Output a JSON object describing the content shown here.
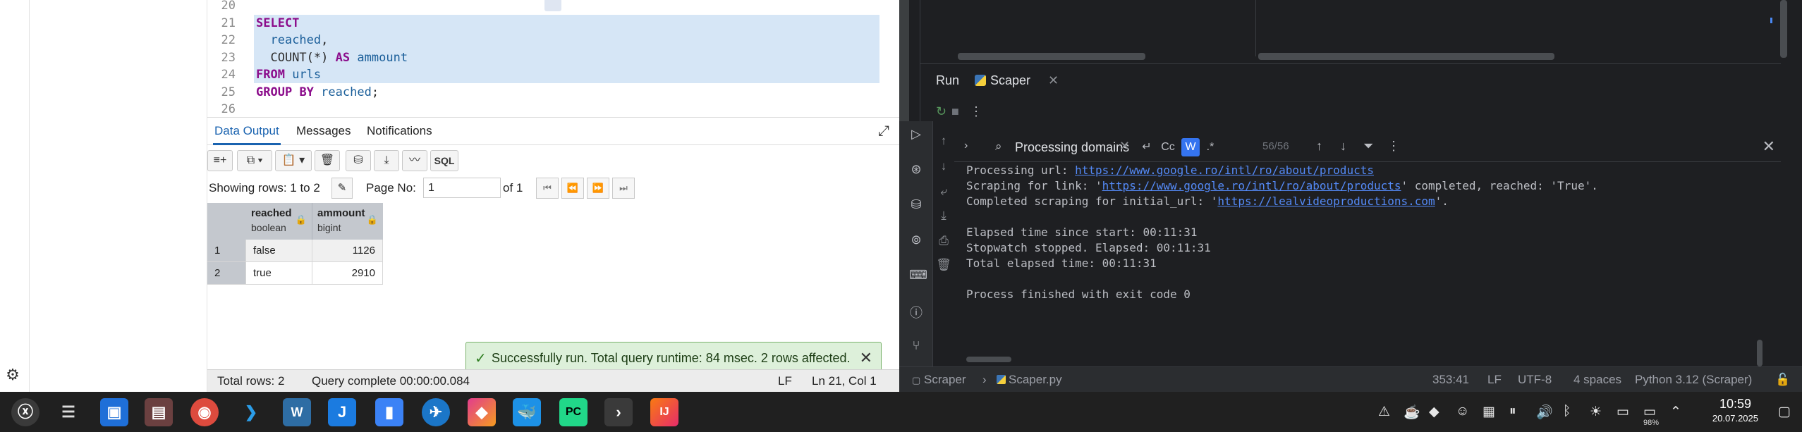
{
  "editor": {
    "lines": [
      {
        "num": "20",
        "text": ""
      },
      {
        "num": "21",
        "text": "SELECT"
      },
      {
        "num": "22",
        "text": "  reached,"
      },
      {
        "num": "23",
        "text": "  COUNT(*) AS ammount"
      },
      {
        "num": "24",
        "text": "FROM urls"
      },
      {
        "num": "25",
        "text": "GROUP BY reached;"
      },
      {
        "num": "26",
        "text": ""
      }
    ]
  },
  "results": {
    "tabs": [
      "Data Output",
      "Messages",
      "Notifications"
    ],
    "active_tab": "Data Output",
    "toolbar_sql_label": "SQL",
    "showing_rows": "Showing rows: 1 to 2",
    "page_no_label": "Page No:",
    "page_no_value": "1",
    "page_of": "of 1",
    "columns": [
      {
        "name": "reached",
        "type": "boolean"
      },
      {
        "name": "ammount",
        "type": "bigint"
      }
    ],
    "rows": [
      {
        "n": "1",
        "reached": "false",
        "ammount": "1126"
      },
      {
        "n": "2",
        "reached": "true",
        "ammount": "2910"
      }
    ],
    "toast": "Successfully run. Total query runtime: 84 msec. 2 rows affected.",
    "status": {
      "total_rows": "Total rows: 2",
      "query_complete": "Query complete 00:00:00.084",
      "line_ending": "LF",
      "position": "Ln 21, Col 1"
    }
  },
  "ide": {
    "run_tab": "Run",
    "config_tab": "Scaper",
    "search": {
      "query": "Processing domains",
      "opt_case": "Cc",
      "opt_word": "W",
      "opt_regex": ".*",
      "count": "56/56"
    },
    "console": [
      {
        "before": "Processing url: ",
        "link": "https://www.google.ro/intl/ro/about/products",
        "after": ""
      },
      {
        "before": "Scraping for link: '",
        "link": "https://www.google.ro/intl/ro/about/products",
        "after": "' completed, reached: 'True'."
      },
      {
        "before": "Completed scraping for initial_url: '",
        "link": "https://lealvideoproductions.com",
        "after": "'."
      },
      {
        "before": "",
        "link": "",
        "after": ""
      },
      {
        "before": "Elapsed time since start: 00:11:31",
        "link": "",
        "after": ""
      },
      {
        "before": "Stopwatch stopped. Elapsed: 00:11:31",
        "link": "",
        "after": ""
      },
      {
        "before": "Total elapsed time: 00:11:31",
        "link": "",
        "after": ""
      },
      {
        "before": "",
        "link": "",
        "after": ""
      },
      {
        "before": "Process finished with exit code 0",
        "link": "",
        "after": ""
      }
    ],
    "status": {
      "project": "Scraper",
      "file": "Scaper.py",
      "position": "353:41",
      "line_ending": "LF",
      "encoding": "UTF-8",
      "indent": "4 spaces",
      "interpreter": "Python 3.12 (Scraper)"
    }
  },
  "taskbar": {
    "battery": "98%",
    "time": "10:59",
    "date": "20.07.2025",
    "apps": [
      "x-app-icon",
      "settings-sliders-icon",
      "store-icon",
      "files-icon",
      "chrome-icon",
      "vscode-icon",
      "writer-icon",
      "j-app-icon",
      "docs-icon",
      "wing-icon",
      "appcode-icon",
      "docker-icon",
      "pycharm-icon",
      "terminal-icon",
      "intellij-icon"
    ]
  }
}
